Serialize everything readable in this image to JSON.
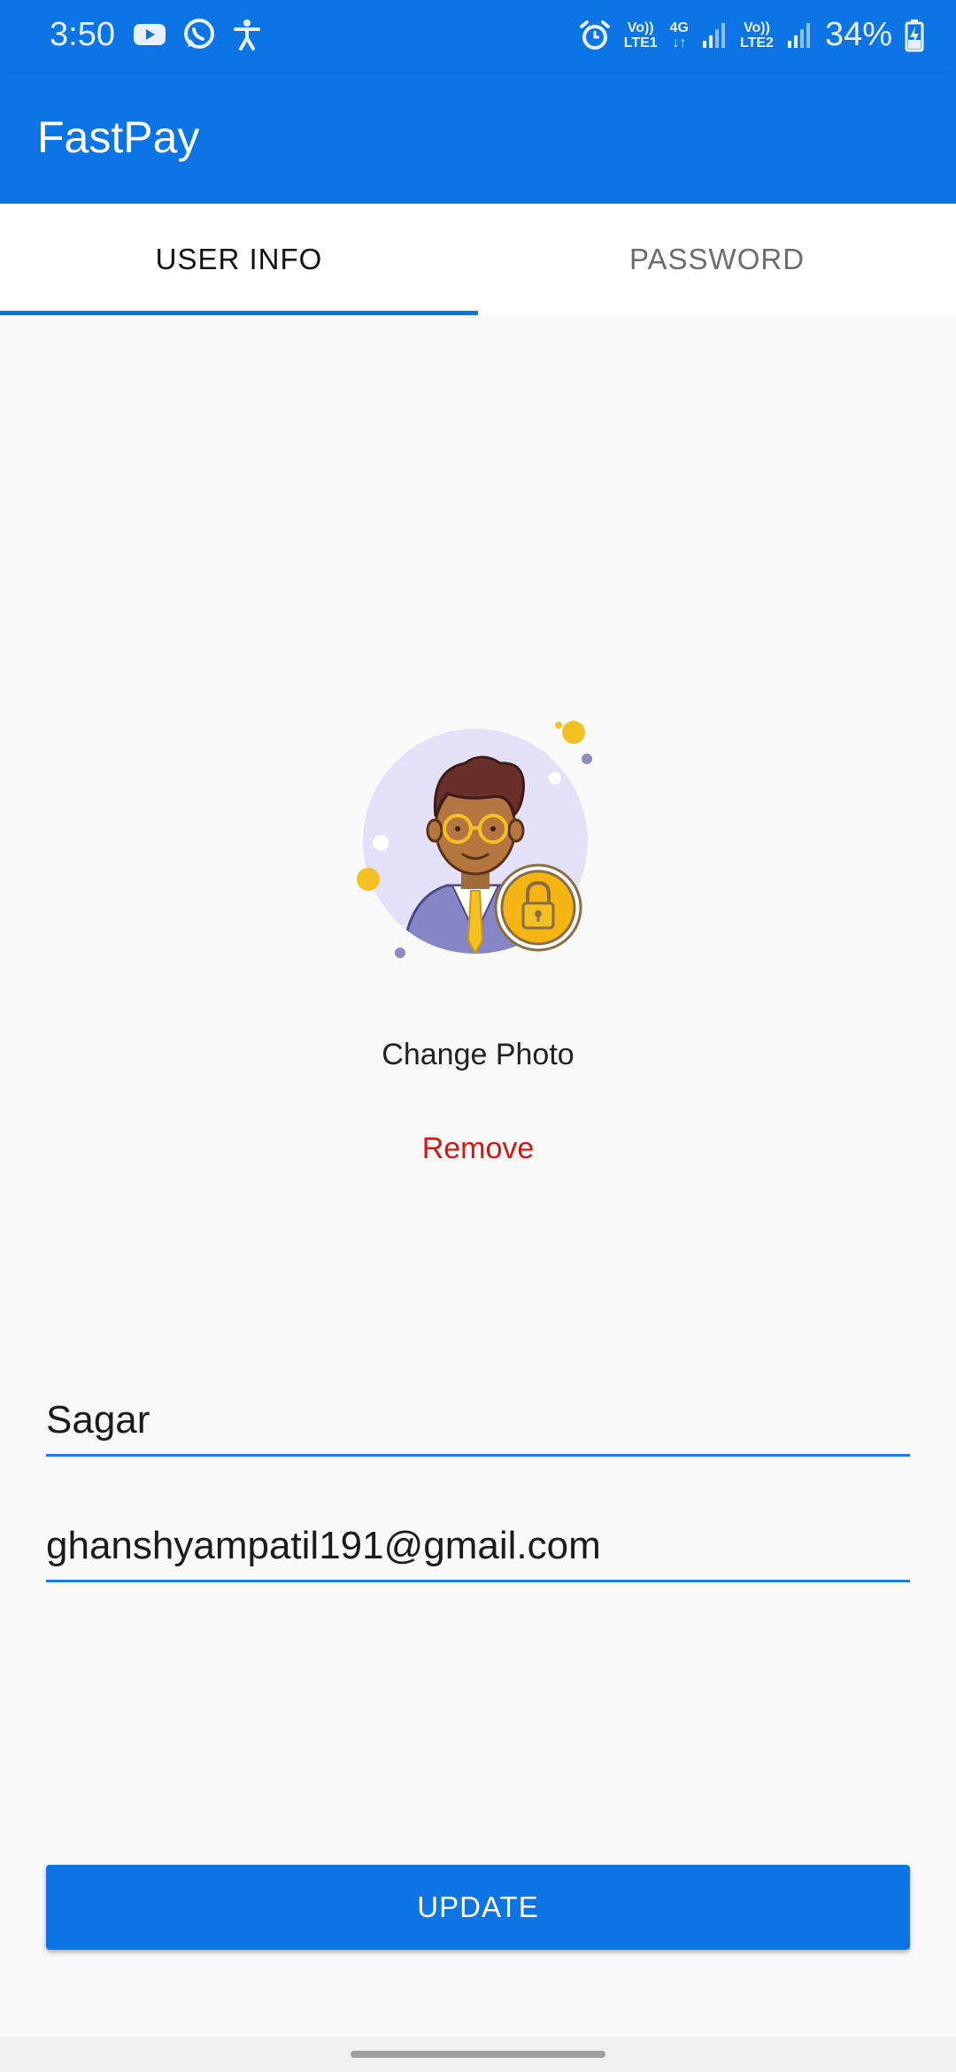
{
  "status_bar": {
    "time": "3:50",
    "left_icons": [
      "youtube-icon",
      "whatsapp-icon",
      "accessibility-icon"
    ],
    "right_icons": [
      "alarm-icon",
      "signal-icon",
      "signal-icon",
      "battery-charging-icon"
    ],
    "sim1_top": "Vo))",
    "sim1_bottom": "LTE1",
    "network_type": "4G",
    "sim2_top": "Vo))",
    "sim2_bottom": "LTE2",
    "battery": "34%"
  },
  "app_bar": {
    "title": "FastPay",
    "color": "#0d74e6"
  },
  "tabs": [
    {
      "label": "USER INFO",
      "active": true
    },
    {
      "label": "PASSWORD",
      "active": false
    }
  ],
  "profile": {
    "avatar_icon": "user-avatar-lock-icon",
    "change_photo_label": "Change Photo",
    "remove_label": "Remove",
    "remove_color": "#d91414"
  },
  "form": {
    "name_value": "Sagar",
    "email_value": "ghanshyampatil191@gmail.com"
  },
  "update_button": {
    "label": "UPDATE"
  }
}
